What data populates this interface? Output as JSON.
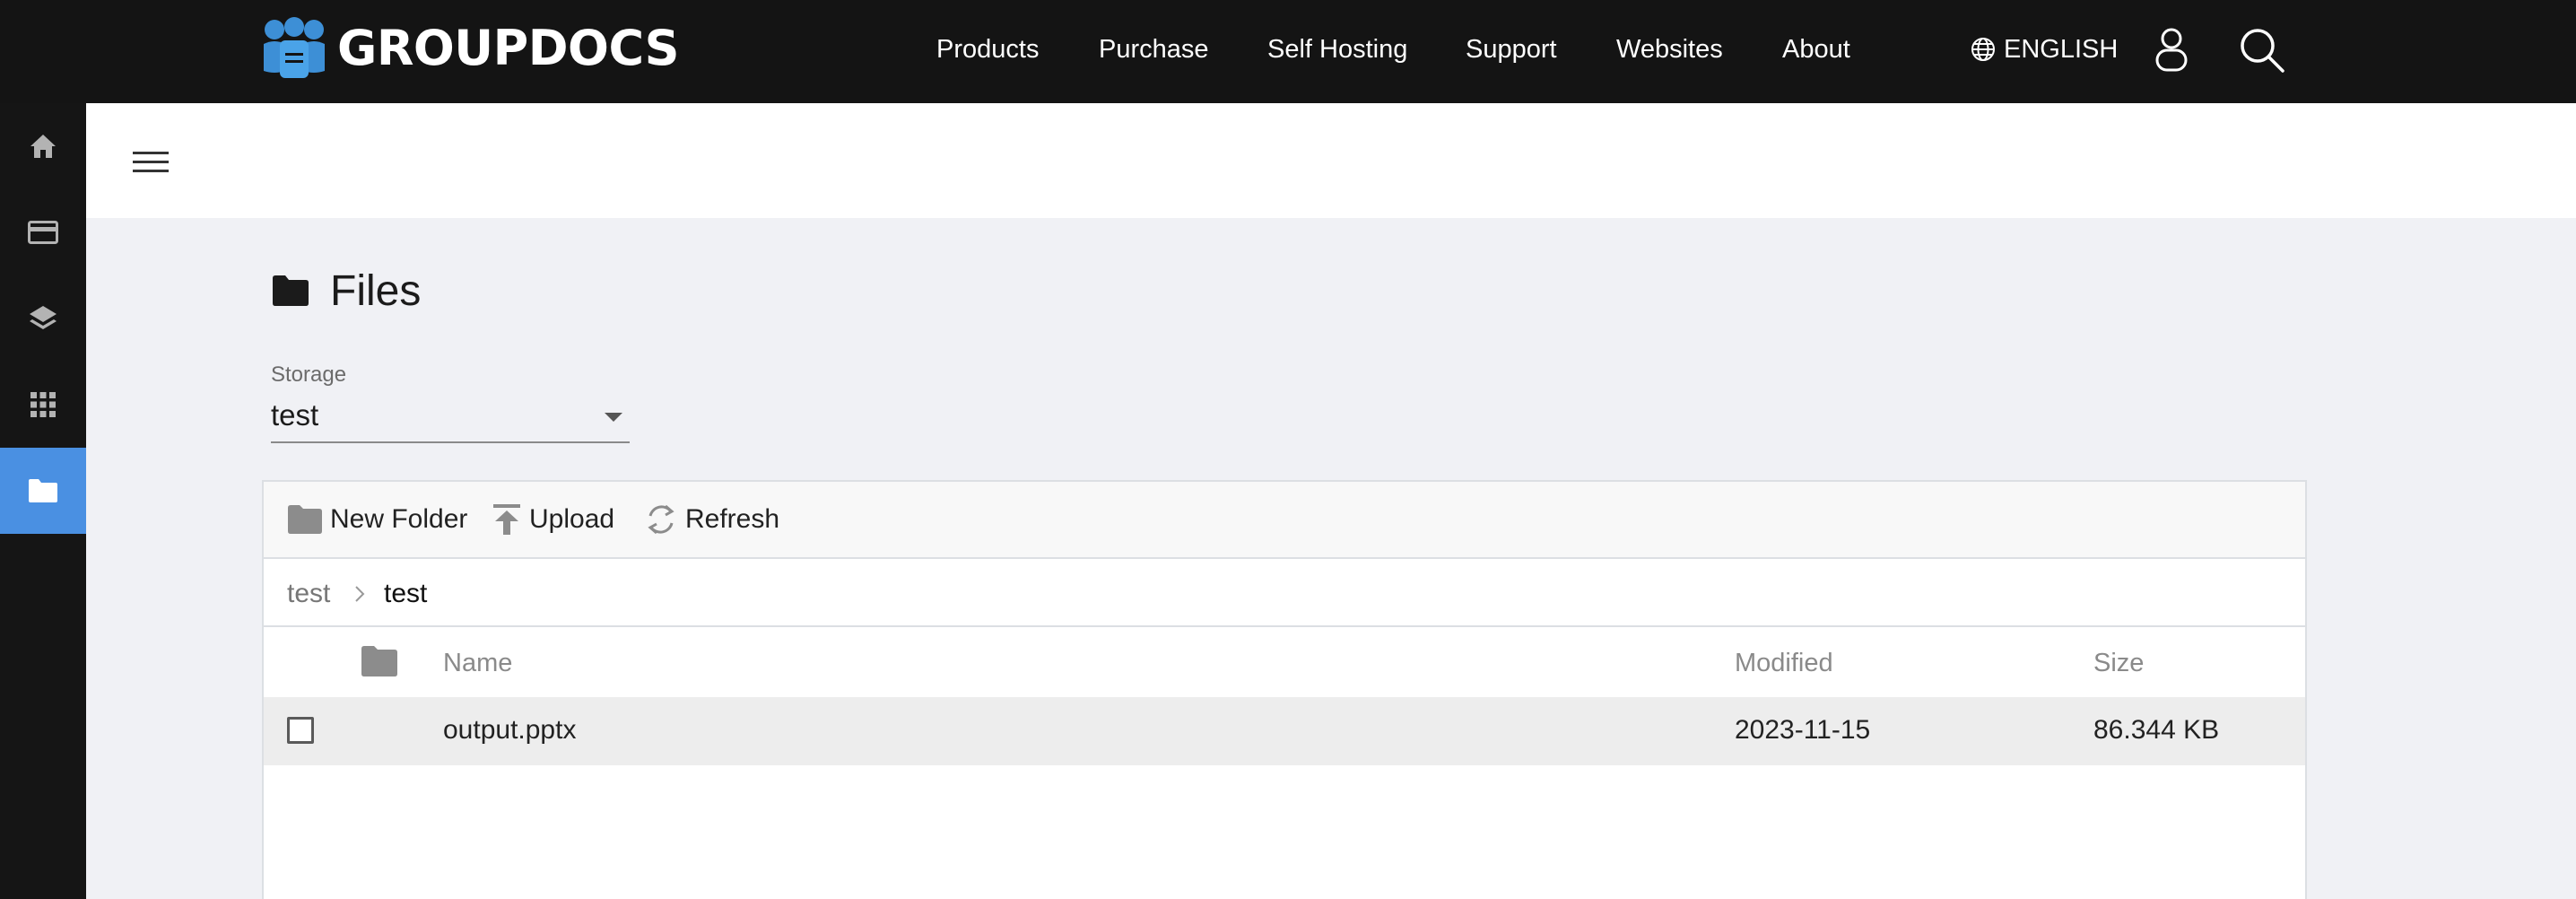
{
  "brand": {
    "name": "GROUPDOCS",
    "accent": "#4a90e2",
    "logo_icon": "groupdocs-logo-icon"
  },
  "topnav": {
    "items": [
      "Products",
      "Purchase",
      "Self Hosting",
      "Support",
      "Websites",
      "About"
    ],
    "language": "ENGLISH",
    "icons": [
      "globe-icon",
      "user-icon",
      "search-icon"
    ]
  },
  "sidebar": {
    "items": [
      {
        "icon": "home-icon",
        "active": false
      },
      {
        "icon": "credit-card-icon",
        "active": false
      },
      {
        "icon": "layers-icon",
        "active": false
      },
      {
        "icon": "apps-grid-icon",
        "active": false
      },
      {
        "icon": "folder-icon",
        "active": true
      }
    ]
  },
  "header": {
    "menu_icon": "hamburger-icon"
  },
  "page": {
    "title": "Files",
    "title_icon": "folder-icon"
  },
  "storage": {
    "label": "Storage",
    "value": "test"
  },
  "toolbar": {
    "new_folder": "New Folder",
    "upload": "Upload",
    "refresh": "Refresh"
  },
  "breadcrumb": [
    "test",
    "test"
  ],
  "table": {
    "columns": {
      "name": "Name",
      "modified": "Modified",
      "size": "Size"
    },
    "rows": [
      {
        "name": "output.pptx",
        "modified": "2023-11-15",
        "size": "86.344 KB",
        "checked": false
      }
    ]
  }
}
